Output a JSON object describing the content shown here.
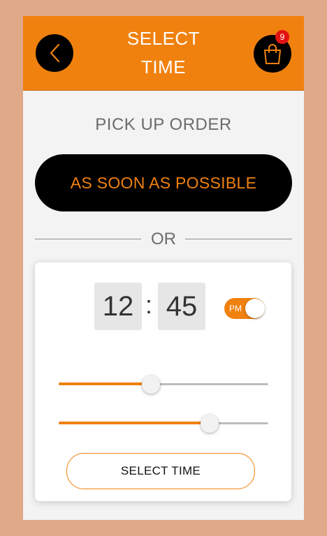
{
  "header": {
    "title_line1": "SELECT",
    "title_line2": "TIME",
    "cart_count": "9",
    "accent_color": "#f0810f"
  },
  "pickup": {
    "heading": "PICK UP ORDER",
    "asap_label": "AS SOON AS POSSIBLE",
    "or_label": "OR"
  },
  "time_picker": {
    "hour": "12",
    "separator": ":",
    "minute": "45",
    "ampm_label": "PM",
    "ampm_on": true,
    "hour_slider_fraction": 0.44,
    "minute_slider_fraction": 0.72,
    "select_label": "SELECT TIME"
  },
  "icons": [
    "chevron-left-icon",
    "shopping-bag-icon"
  ]
}
